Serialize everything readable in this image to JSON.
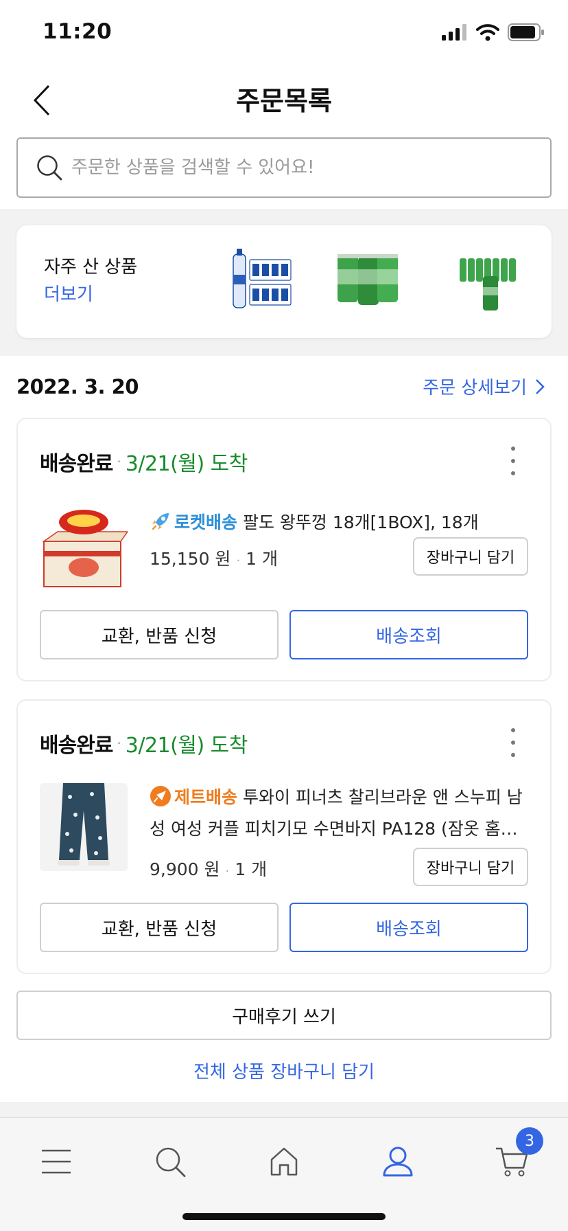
{
  "status_bar": {
    "time": "11:20"
  },
  "header": {
    "title": "주문목록"
  },
  "search": {
    "placeholder": "주문한 상품을 검색할 수 있어요!"
  },
  "frequent": {
    "title": "자주 산 상품",
    "more_label": "더보기",
    "items": [
      "water-bottles-thumbnail",
      "green-cans-thumbnail",
      "green-cans-pack-thumbnail"
    ]
  },
  "order_group": {
    "date": "2022. 3. 20",
    "detail_label": "주문 상세보기"
  },
  "orders": [
    {
      "status": "배송완료",
      "arrival": "3/21(월) 도착",
      "delivery_badge": "로켓배송",
      "title": "팔도 왕뚜껑 18개[1BOX], 18개",
      "price": "15,150 원",
      "qty": "1 개",
      "cart_label": "장바구니 담기",
      "exchange_label": "교환, 반품 신청",
      "track_label": "배송조회"
    },
    {
      "status": "배송완료",
      "arrival": "3/21(월) 도착",
      "delivery_badge": "제트배송",
      "title": "투와이 피너츠 찰리브라운 앤 스누피 남성 여성 커플 피치기모 수면바지 PA128 (잠옷 홈…",
      "price": "9,900 원",
      "qty": "1 개",
      "cart_label": "장바구니 담기",
      "exchange_label": "교환, 반품 신청",
      "track_label": "배송조회"
    }
  ],
  "review_label": "구매후기 쓰기",
  "all_cart_label": "전체 상품 장바구니 담기",
  "tab_bar": {
    "cart_count": "3",
    "active": "my-page",
    "accent": "#3466e4"
  }
}
